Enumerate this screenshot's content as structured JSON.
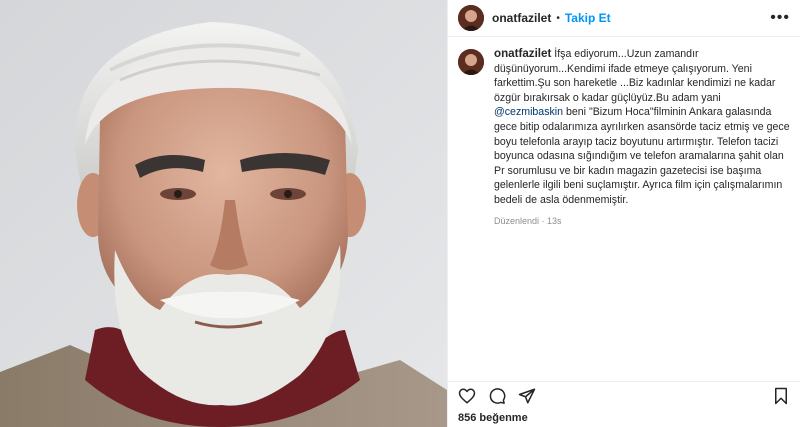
{
  "post": {
    "username": "onatfazilet",
    "follow_label": "Takip Et",
    "more_label": "•••",
    "likes_text": "856 beğenme"
  },
  "caption": {
    "username": "onatfazilet",
    "part1": " İfşa ediyorum...Uzun zamandır düşünüyorum...Kendimi ifade etmeye çalışıyorum. Yeni farkettim.Şu son hareketle ...Biz kadınlar kendimizi ne kadar özgür bırakırsak o kadar güçlüyüz.Bu adam yani ",
    "mention": "@cezmibaskin",
    "part2": " beni \"Bizum Hoca\"filminin Ankara galasında gece bitip odalarımıza ayrılırken asansörde taciz etmiş ve gece boyu telefonla arayıp taciz boyutunu artırmıştır. Telefon tacizi boyunca odasına sığındığım ve telefon aramalarına şahit olan Pr sorumlusu ve bir kadın magazin gazetecisi ise başıma gelenlerle ilgili beni suçlamıştır. Ayrıca film için çalışmalarımın bedeli de asla ödenmemiştir.",
    "edited": "Düzenlendi · 13s"
  },
  "icons": {
    "like": "heart-icon",
    "comment": "comment-icon",
    "share": "share-icon",
    "save": "bookmark-icon"
  },
  "colors": {
    "link_blue": "#0095f6",
    "mention_blue": "#00376b",
    "muted_gray": "#8e8e8e"
  }
}
